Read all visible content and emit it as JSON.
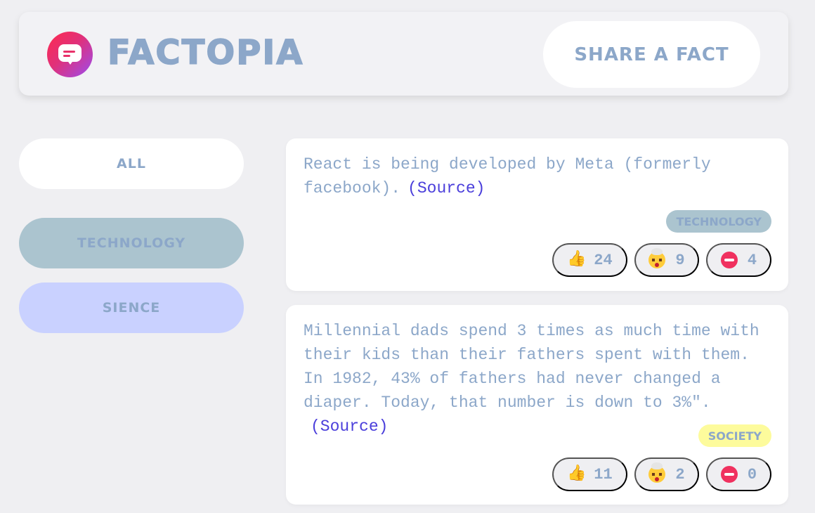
{
  "header": {
    "title": "FACTOPIA",
    "share_label": "SHARE A FACT",
    "logo_icon": "speech-bubble-icon"
  },
  "categories": [
    {
      "label": "ALL",
      "color": "#ffffff"
    },
    {
      "label": "TECHNOLOGY",
      "color": "#abc4cf"
    },
    {
      "label": "SIENCE",
      "color": "#c9d1ff"
    }
  ],
  "facts": [
    {
      "text": "React is being developed by Meta (formerly facebook).",
      "source_label": "(Source)",
      "category": "TECHNOLOGY",
      "category_color": "#abc4cf",
      "votes": {
        "interesting": "24",
        "mindblowing": "9",
        "false": "4"
      }
    },
    {
      "text": "Millennial dads spend 3 times as much time with their kids than their fathers spent with them. In 1982, 43% of fathers had never changed a diaper. Today, that number is down to 3%\".",
      "source_label": "(Source)",
      "category": "SOCIETY",
      "category_color": "#fdfb9c",
      "votes": {
        "interesting": "11",
        "mindblowing": "2",
        "false": "0"
      }
    }
  ],
  "icons": {
    "interesting": "thumbs-up-icon",
    "mindblowing": "mind-blown-icon",
    "false": "no-entry-icon"
  }
}
